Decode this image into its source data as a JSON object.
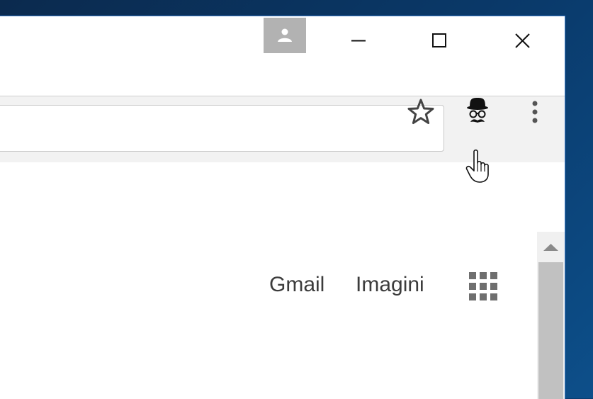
{
  "window": {
    "controls": [
      "minimize",
      "maximize",
      "close"
    ],
    "profile_icon": "person-icon"
  },
  "toolbar": {
    "bookmark_icon": "star-icon",
    "extension_icon": "incognito-mustache-icon",
    "menu_icon": "kebab-menu-icon"
  },
  "content": {
    "links": [
      {
        "label": "Gmail"
      },
      {
        "label": "Imagini"
      }
    ],
    "apps_icon": "apps-grid-icon"
  },
  "colors": {
    "profile_bg": "#b2b2b2",
    "toolbar_bg": "#f2f2f2",
    "text": "#3c3c3c",
    "apps_grid": "#6f6f6f",
    "scroll_thumb": "#c1c1c1"
  }
}
